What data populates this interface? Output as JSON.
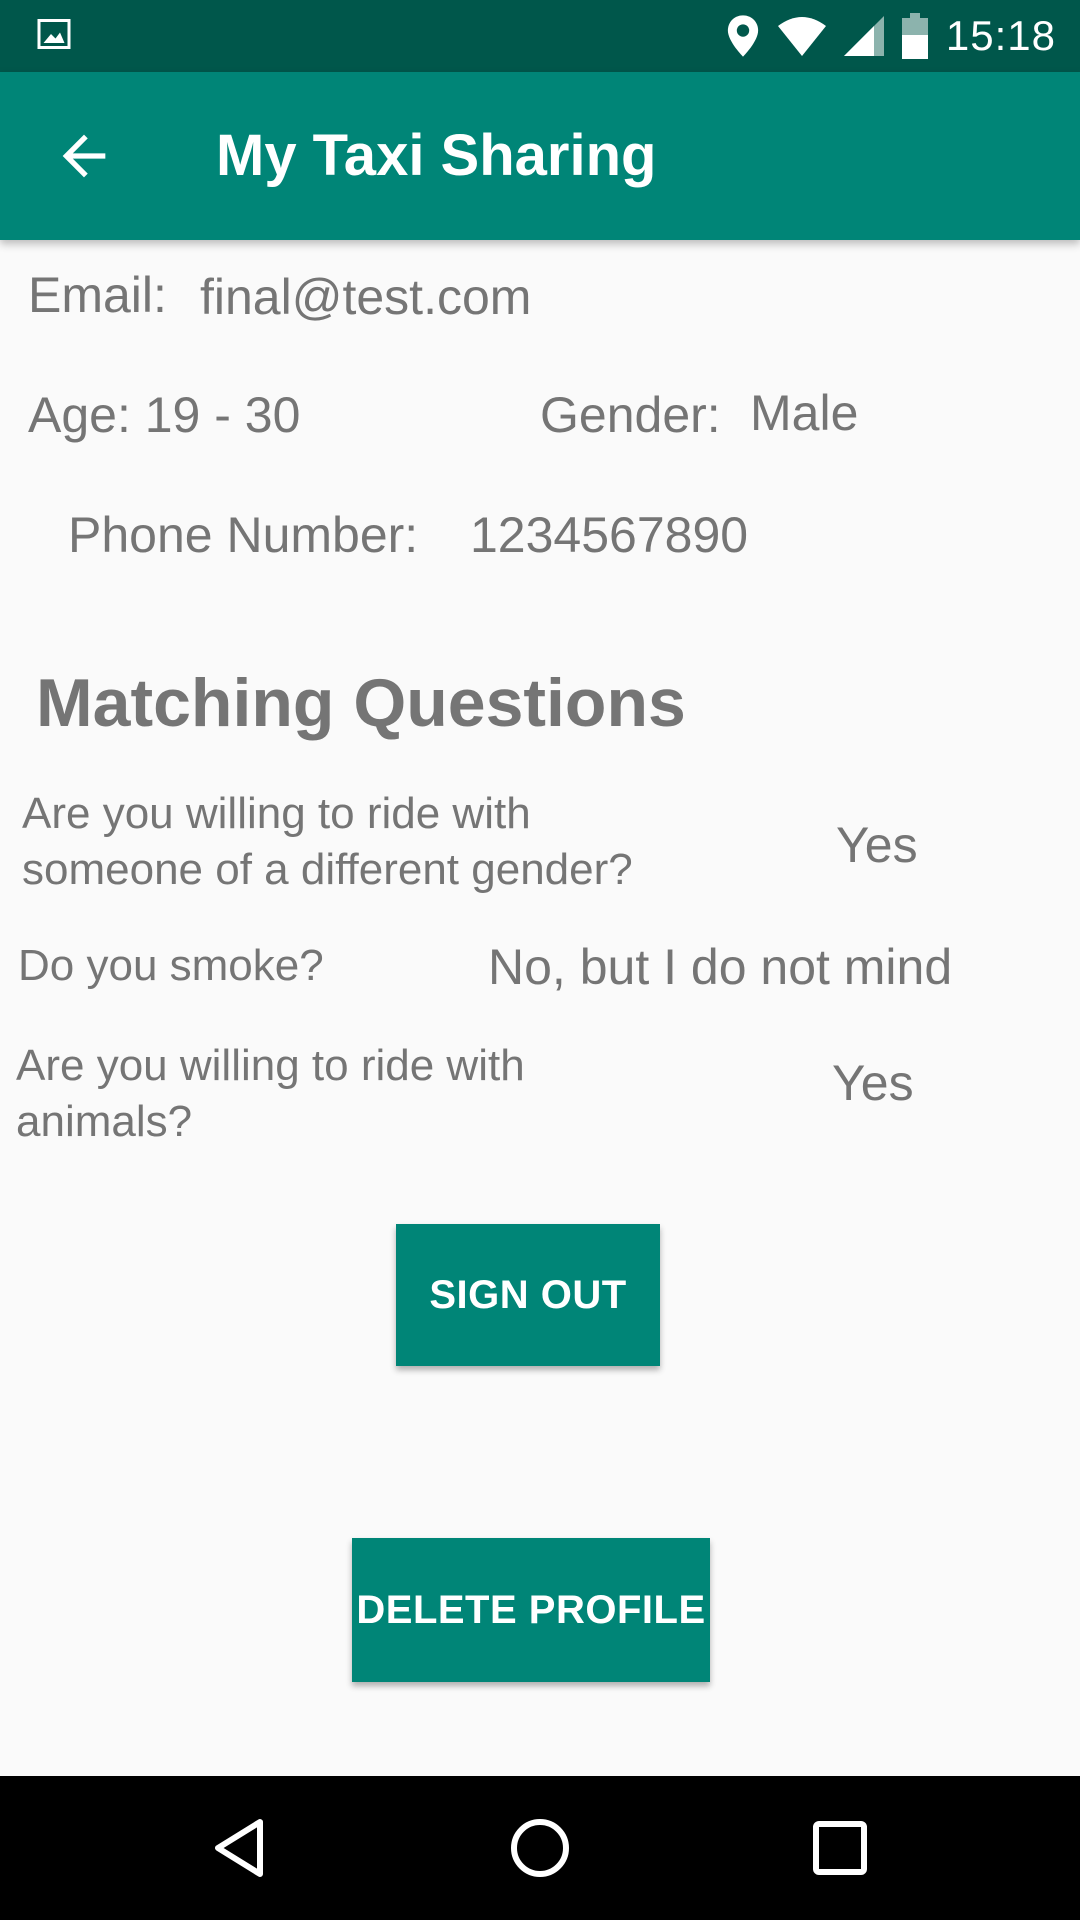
{
  "status_bar": {
    "time": "15:18",
    "icons": [
      "image-icon",
      "location-icon",
      "wifi-icon",
      "signal-icon",
      "battery-icon"
    ]
  },
  "app_bar": {
    "title": "My Taxi Sharing",
    "back_icon": "arrow-back-icon"
  },
  "profile": {
    "email_label": "Email:",
    "email_value": "final@test.com",
    "age": "Age: 19 - 30",
    "gender_label": "Gender:",
    "gender_value": "Male",
    "phone_label": "Phone Number:",
    "phone_value": "1234567890"
  },
  "matching": {
    "heading": "Matching Questions",
    "questions": [
      {
        "question": "Are you willing to ride with someone of a different gender?",
        "answer": "Yes"
      },
      {
        "question": "Do you smoke?",
        "answer": "No, but I do not mind"
      },
      {
        "question": "Are you willing to ride with animals?",
        "answer": "Yes"
      }
    ]
  },
  "buttons": {
    "sign_out": "SIGN OUT",
    "delete_profile": "DELETE PROFILE"
  },
  "nav_bar": {
    "icons": [
      "back-triangle-icon",
      "home-circle-icon",
      "recents-square-icon"
    ]
  },
  "colors": {
    "primary": "#008577",
    "primary_dark": "#00574b",
    "text_gray": "#757575",
    "background": "#fafafa"
  }
}
